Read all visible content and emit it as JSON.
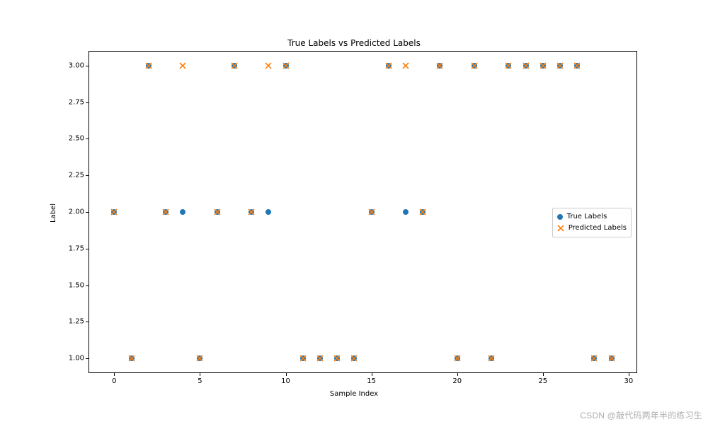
{
  "chart_data": {
    "type": "scatter",
    "title": "True Labels vs Predicted Labels",
    "xlabel": "Sample Index",
    "ylabel": "Label",
    "xlim": [
      -1.5,
      30.5
    ],
    "ylim": [
      0.9,
      3.1
    ],
    "x_ticks": [
      0,
      5,
      10,
      15,
      20,
      25,
      30
    ],
    "y_ticks": [
      1.0,
      1.25,
      1.5,
      1.75,
      2.0,
      2.25,
      2.5,
      2.75,
      3.0
    ],
    "x_tick_labels": [
      "0",
      "5",
      "10",
      "15",
      "20",
      "25",
      "30"
    ],
    "y_tick_labels": [
      "1.00",
      "1.25",
      "1.50",
      "1.75",
      "2.00",
      "2.25",
      "2.50",
      "2.75",
      "3.00"
    ],
    "legend": [
      "True Labels",
      "Predicted Labels"
    ],
    "x": [
      0,
      1,
      2,
      3,
      4,
      5,
      6,
      7,
      8,
      9,
      10,
      11,
      12,
      13,
      14,
      15,
      16,
      17,
      18,
      19,
      20,
      21,
      22,
      23,
      24,
      25,
      26,
      27,
      28,
      29
    ],
    "series": [
      {
        "name": "True Labels",
        "marker": "circle",
        "color": "#1f77b4",
        "values": [
          2,
          1,
          3,
          2,
          2,
          1,
          2,
          3,
          2,
          2,
          3,
          1,
          1,
          1,
          1,
          2,
          3,
          2,
          2,
          3,
          1,
          3,
          1,
          3,
          3,
          3,
          3,
          3,
          1,
          1
        ]
      },
      {
        "name": "Predicted Labels",
        "marker": "x",
        "color": "#ff7f0e",
        "values": [
          2,
          1,
          3,
          2,
          3,
          1,
          2,
          3,
          2,
          3,
          3,
          1,
          1,
          1,
          1,
          2,
          3,
          3,
          2,
          3,
          1,
          3,
          1,
          3,
          3,
          3,
          3,
          3,
          1,
          1
        ]
      }
    ]
  },
  "watermark": "CSDN @敲代码两年半的练习生"
}
